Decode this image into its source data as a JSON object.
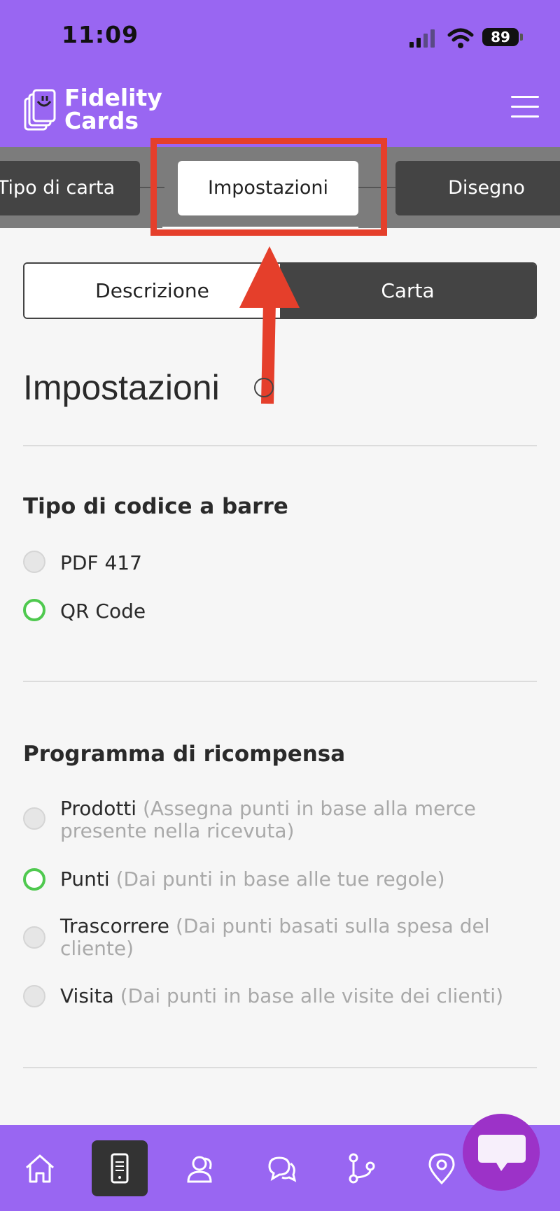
{
  "status_bar": {
    "time": "11:09",
    "battery": "89"
  },
  "header": {
    "logo_line1": "Fidelity",
    "logo_line2": "Cards"
  },
  "step_tabs": [
    {
      "label": "Tipo di carta"
    },
    {
      "label": "Impostazioni"
    },
    {
      "label": "Disegno"
    }
  ],
  "segmented": {
    "description": "Descrizione",
    "card": "Carta"
  },
  "page_title": "Impostazioni",
  "barcode_section": {
    "title": "Tipo di codice a barre",
    "options": [
      {
        "label": "PDF 417",
        "selected": false
      },
      {
        "label": "QR Code",
        "selected": true
      }
    ]
  },
  "reward_section": {
    "title": "Programma di ricompensa",
    "options": [
      {
        "label": "Prodotti",
        "hint": "(Assegna punti in base alla merce presente nella ricevuta)",
        "selected": false
      },
      {
        "label": "Punti",
        "hint": "(Dai punti in base alle tue regole)",
        "selected": true
      },
      {
        "label": "Trascorrere",
        "hint": "(Dai punti basati sulla spesa del cliente)",
        "selected": false
      },
      {
        "label": "Visita",
        "hint": "(Dai punti in base alle visite dei clienti)",
        "selected": false
      }
    ]
  },
  "bottom_nav": {
    "items": [
      "home-icon",
      "card-device-icon",
      "customers-icon",
      "chat-icon",
      "workflow-icon",
      "location-icon"
    ],
    "active": "card-device-icon"
  },
  "colors": {
    "brand_purple": "#9966f2",
    "dark_gray": "#444444",
    "radio_selected": "#4fc94f",
    "annotation_red": "#e53f2b",
    "chat_fab": "#9c32c8"
  }
}
